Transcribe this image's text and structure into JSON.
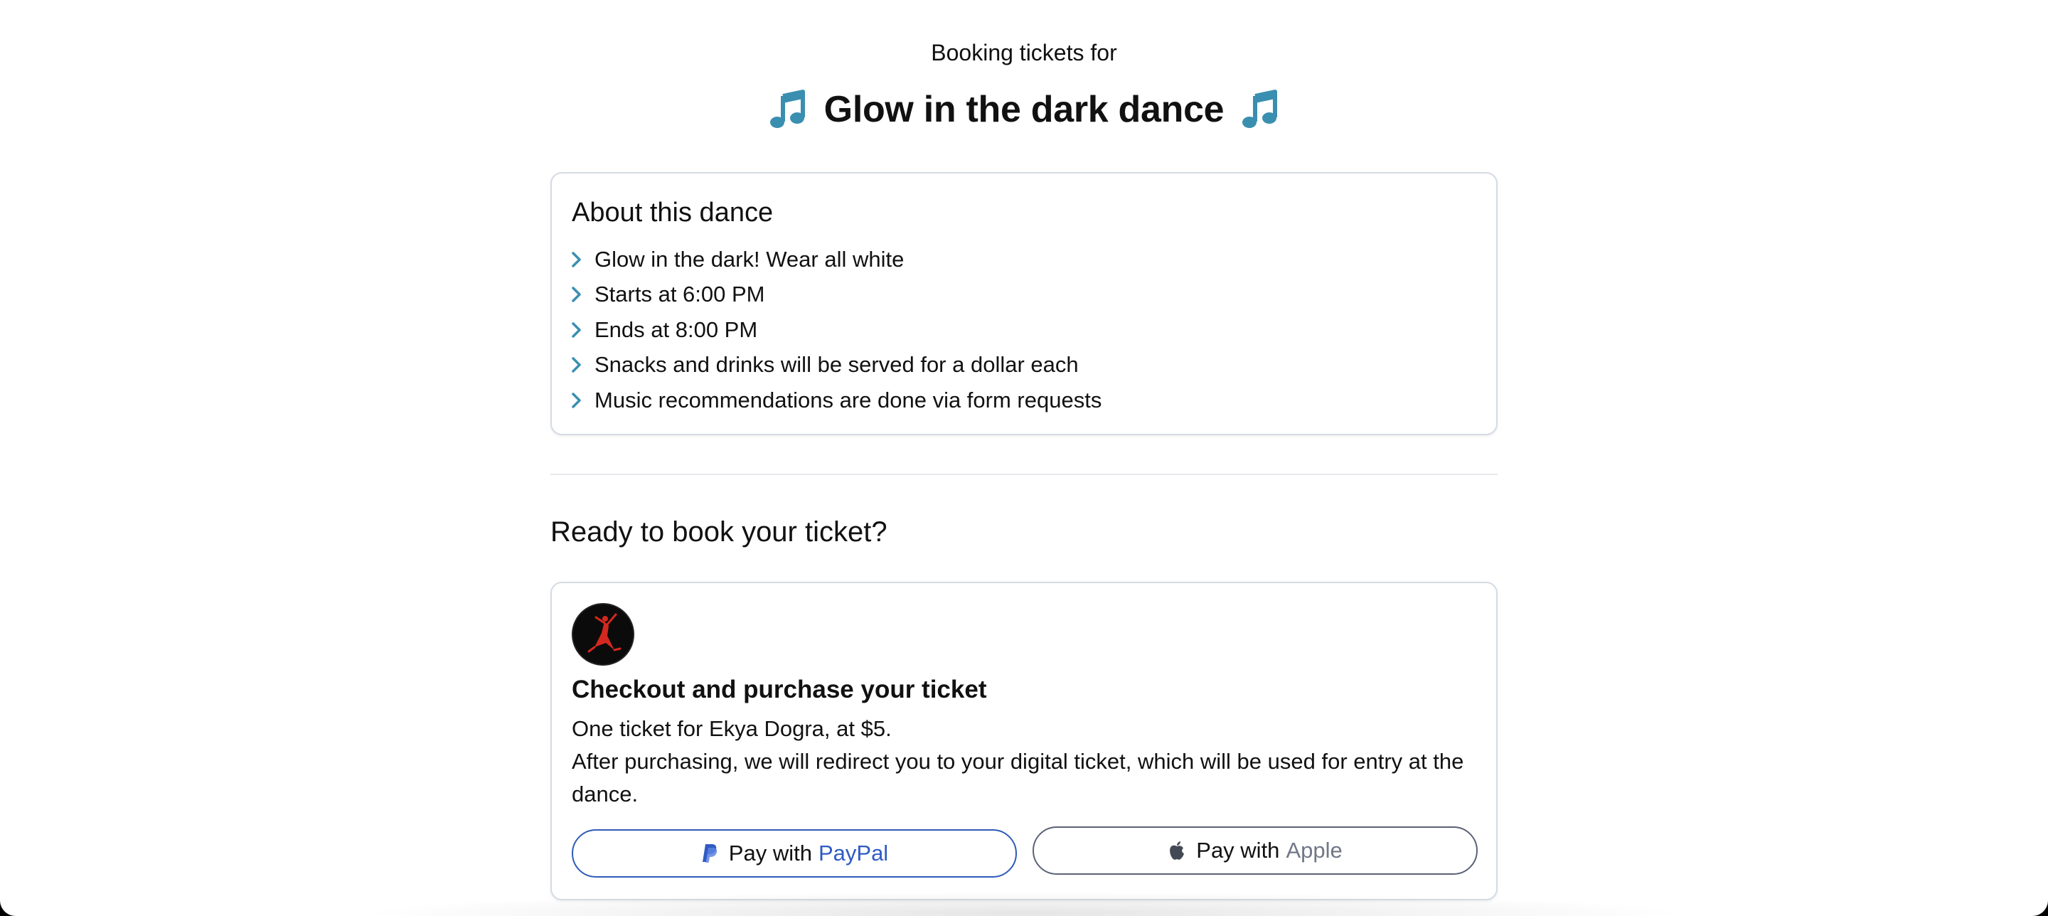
{
  "header": {
    "pre_title": "Booking tickets for",
    "title": "Glow in the dark dance",
    "left_icon": "music-note-icon",
    "right_icon": "music-note-icon",
    "icon_color": "#3a8fb0"
  },
  "about": {
    "heading": "About this dance",
    "items": [
      "Glow in the dark! Wear all white",
      "Starts at 6:00 PM",
      "Ends at 8:00 PM",
      "Snacks and drinks will be served for a dollar each",
      "Music recommendations are done via form requests"
    ],
    "bullet_icon": "chevron-right-icon",
    "bullet_color": "#3a8fb0"
  },
  "ready": {
    "heading": "Ready to book your ticket?"
  },
  "checkout": {
    "logo_icon": "dancer-logo",
    "heading": "Checkout and purchase your ticket",
    "line1": "One ticket for Ekya Dogra, at $5.",
    "line2": "After purchasing, we will redirect you to your digital ticket, which will be used for entry at the dance.",
    "paypal_button": {
      "prefix": "Pay with",
      "brand": "PayPal",
      "icon": "paypal-icon",
      "accent": "#2f5bc4"
    },
    "apple_button": {
      "prefix": "Pay with",
      "brand": "Apple",
      "icon": "apple-icon",
      "accent": "#707786"
    }
  }
}
